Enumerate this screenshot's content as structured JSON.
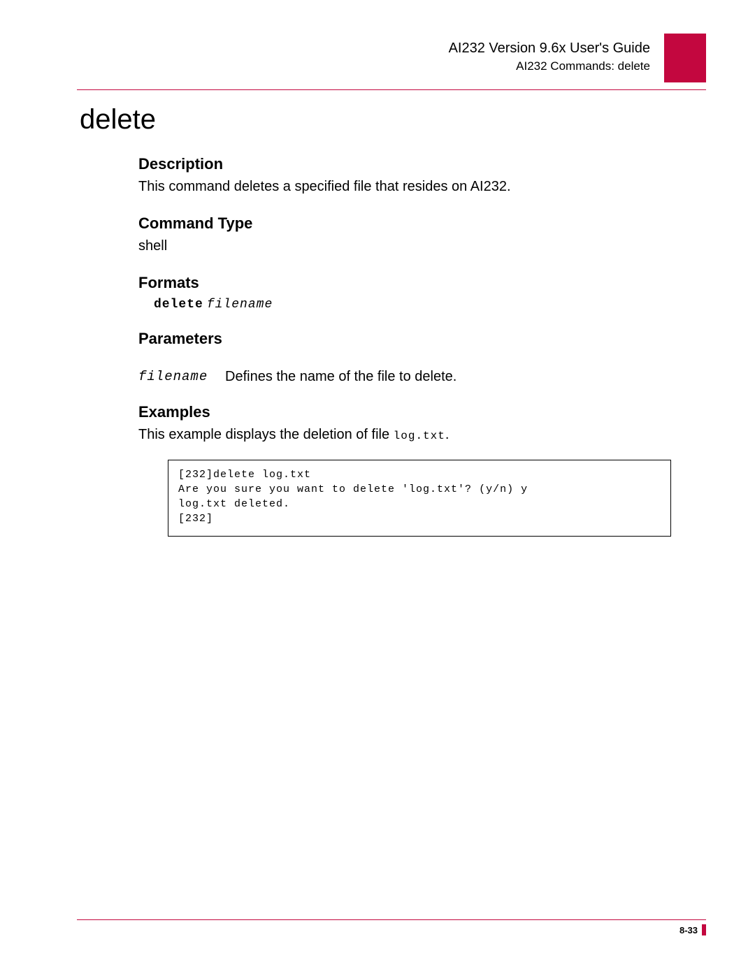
{
  "header": {
    "guide_title": "AI232 Version 9.6x User's Guide",
    "breadcrumb": "AI232 Commands: delete"
  },
  "command": {
    "title": "delete",
    "sections": {
      "description": {
        "heading": "Description",
        "text": "This command deletes a specified file that resides on AI232."
      },
      "command_type": {
        "heading": "Command Type",
        "text": "shell"
      },
      "formats": {
        "heading": "Formats",
        "cmd": "delete",
        "arg": "filename"
      },
      "parameters": {
        "heading": "Parameters",
        "rows": [
          {
            "name": "filename",
            "desc": "Defines the name of the file to delete."
          }
        ]
      },
      "examples": {
        "heading": "Examples",
        "intro_prefix": "This example displays the deletion of file ",
        "intro_file": "log.txt",
        "intro_suffix": ".",
        "block": "[232]delete log.txt\nAre you sure you want to delete 'log.txt'? (y/n) y\nlog.txt deleted.\n[232]"
      }
    }
  },
  "footer": {
    "page": "8-33"
  }
}
